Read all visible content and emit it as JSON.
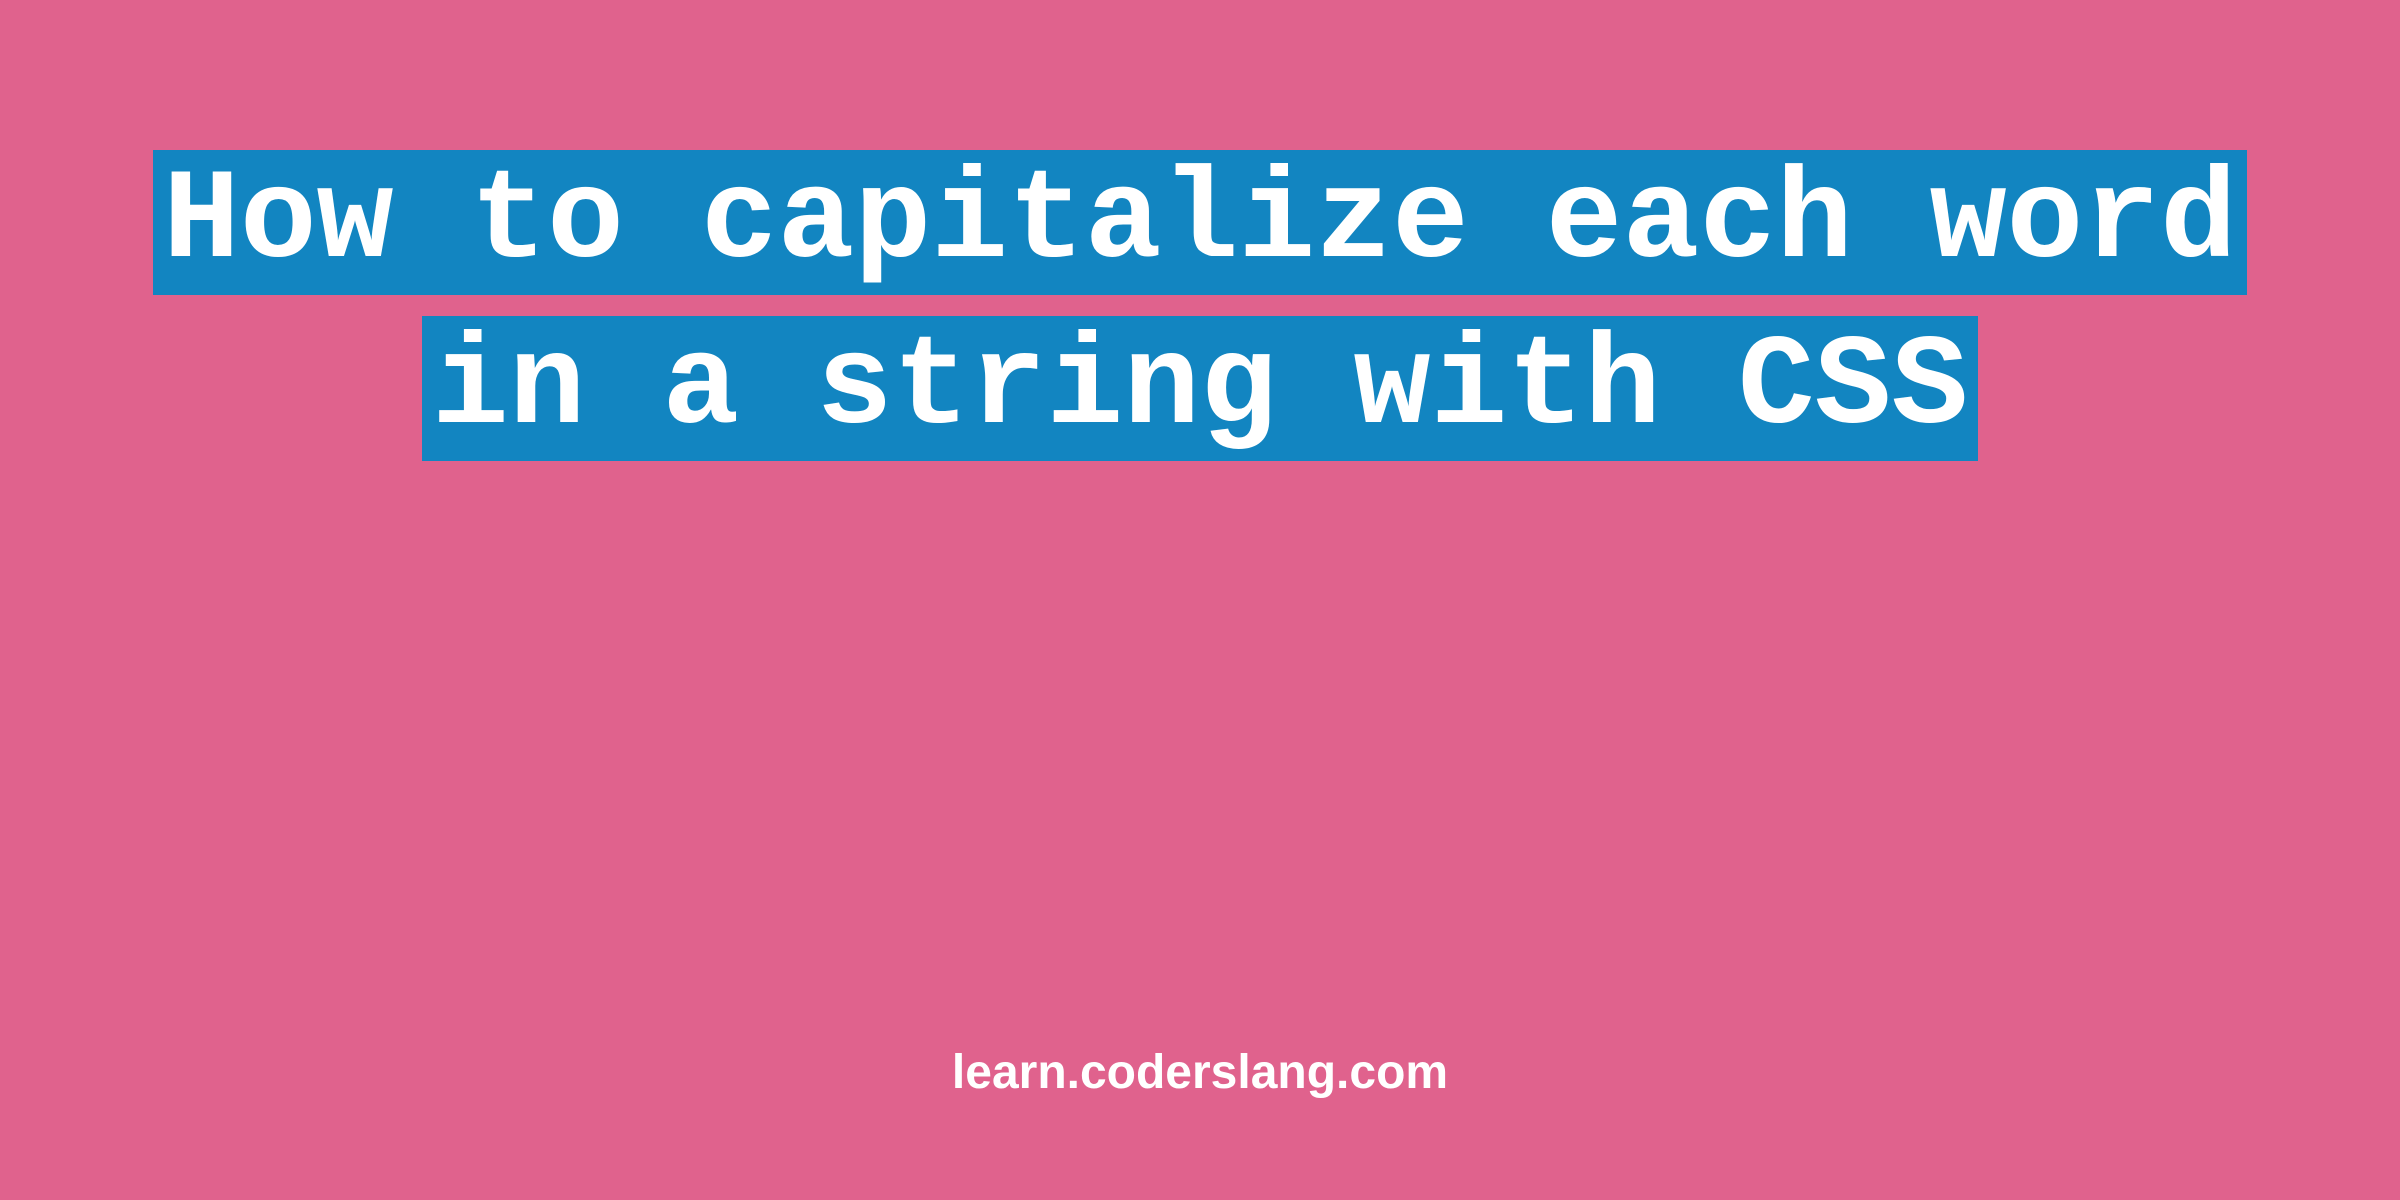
{
  "title": "How to capitalize each word in a string with CSS",
  "footer": "learn.coderslang.com",
  "colors": {
    "background": "#e0628d",
    "highlight": "#1285c1",
    "text": "#ffffff"
  }
}
